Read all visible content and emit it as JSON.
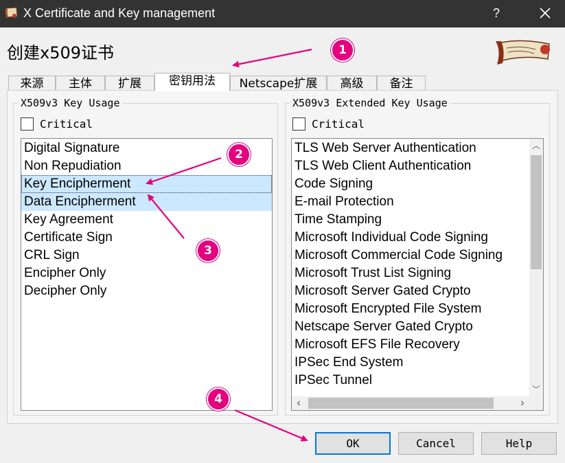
{
  "window": {
    "title": "X Certificate and Key management",
    "help_glyph": "?",
    "close_glyph_name": "close-icon"
  },
  "dialog": {
    "heading": "创建x509证书"
  },
  "tabs": [
    {
      "label": "来源",
      "active": false
    },
    {
      "label": "主体",
      "active": false
    },
    {
      "label": "扩展",
      "active": false
    },
    {
      "label": "密钥用法",
      "active": true
    },
    {
      "label": "Netscape扩展",
      "active": false
    },
    {
      "label": "高级",
      "active": false
    },
    {
      "label": "备注",
      "active": false
    }
  ],
  "key_usage": {
    "legend": "X509v3 Key Usage",
    "critical_label": "Critical",
    "critical_checked": false,
    "items": [
      {
        "label": "Digital Signature",
        "state": "normal"
      },
      {
        "label": "Non Repudiation",
        "state": "normal"
      },
      {
        "label": "Key Encipherment",
        "state": "focused"
      },
      {
        "label": "Data Encipherment",
        "state": "selected"
      },
      {
        "label": "Key Agreement",
        "state": "normal"
      },
      {
        "label": "Certificate Sign",
        "state": "normal"
      },
      {
        "label": "CRL Sign",
        "state": "normal"
      },
      {
        "label": "Encipher Only",
        "state": "normal"
      },
      {
        "label": "Decipher Only",
        "state": "normal"
      }
    ]
  },
  "extended_key_usage": {
    "legend": "X509v3 Extended Key Usage",
    "critical_label": "Critical",
    "critical_checked": false,
    "items": [
      {
        "label": "TLS Web Server Authentication"
      },
      {
        "label": "TLS Web Client Authentication"
      },
      {
        "label": "Code Signing"
      },
      {
        "label": "E-mail Protection"
      },
      {
        "label": "Time Stamping"
      },
      {
        "label": "Microsoft Individual Code Signing"
      },
      {
        "label": "Microsoft Commercial Code Signing"
      },
      {
        "label": "Microsoft Trust List Signing"
      },
      {
        "label": "Microsoft Server Gated Crypto"
      },
      {
        "label": "Microsoft Encrypted File System"
      },
      {
        "label": "Netscape Server Gated Crypto"
      },
      {
        "label": "Microsoft EFS File Recovery"
      },
      {
        "label": "IPSec End System"
      },
      {
        "label": "IPSec Tunnel"
      }
    ],
    "scroll_up_glyph": "︿",
    "scroll_down_glyph": "﹀",
    "scroll_left_glyph": "‹",
    "scroll_right_glyph": "›"
  },
  "buttons": {
    "ok": "OK",
    "cancel": "Cancel",
    "help": "Help"
  },
  "annotations": {
    "color": "#e4007f",
    "markers": [
      "1",
      "2",
      "3",
      "4"
    ]
  }
}
